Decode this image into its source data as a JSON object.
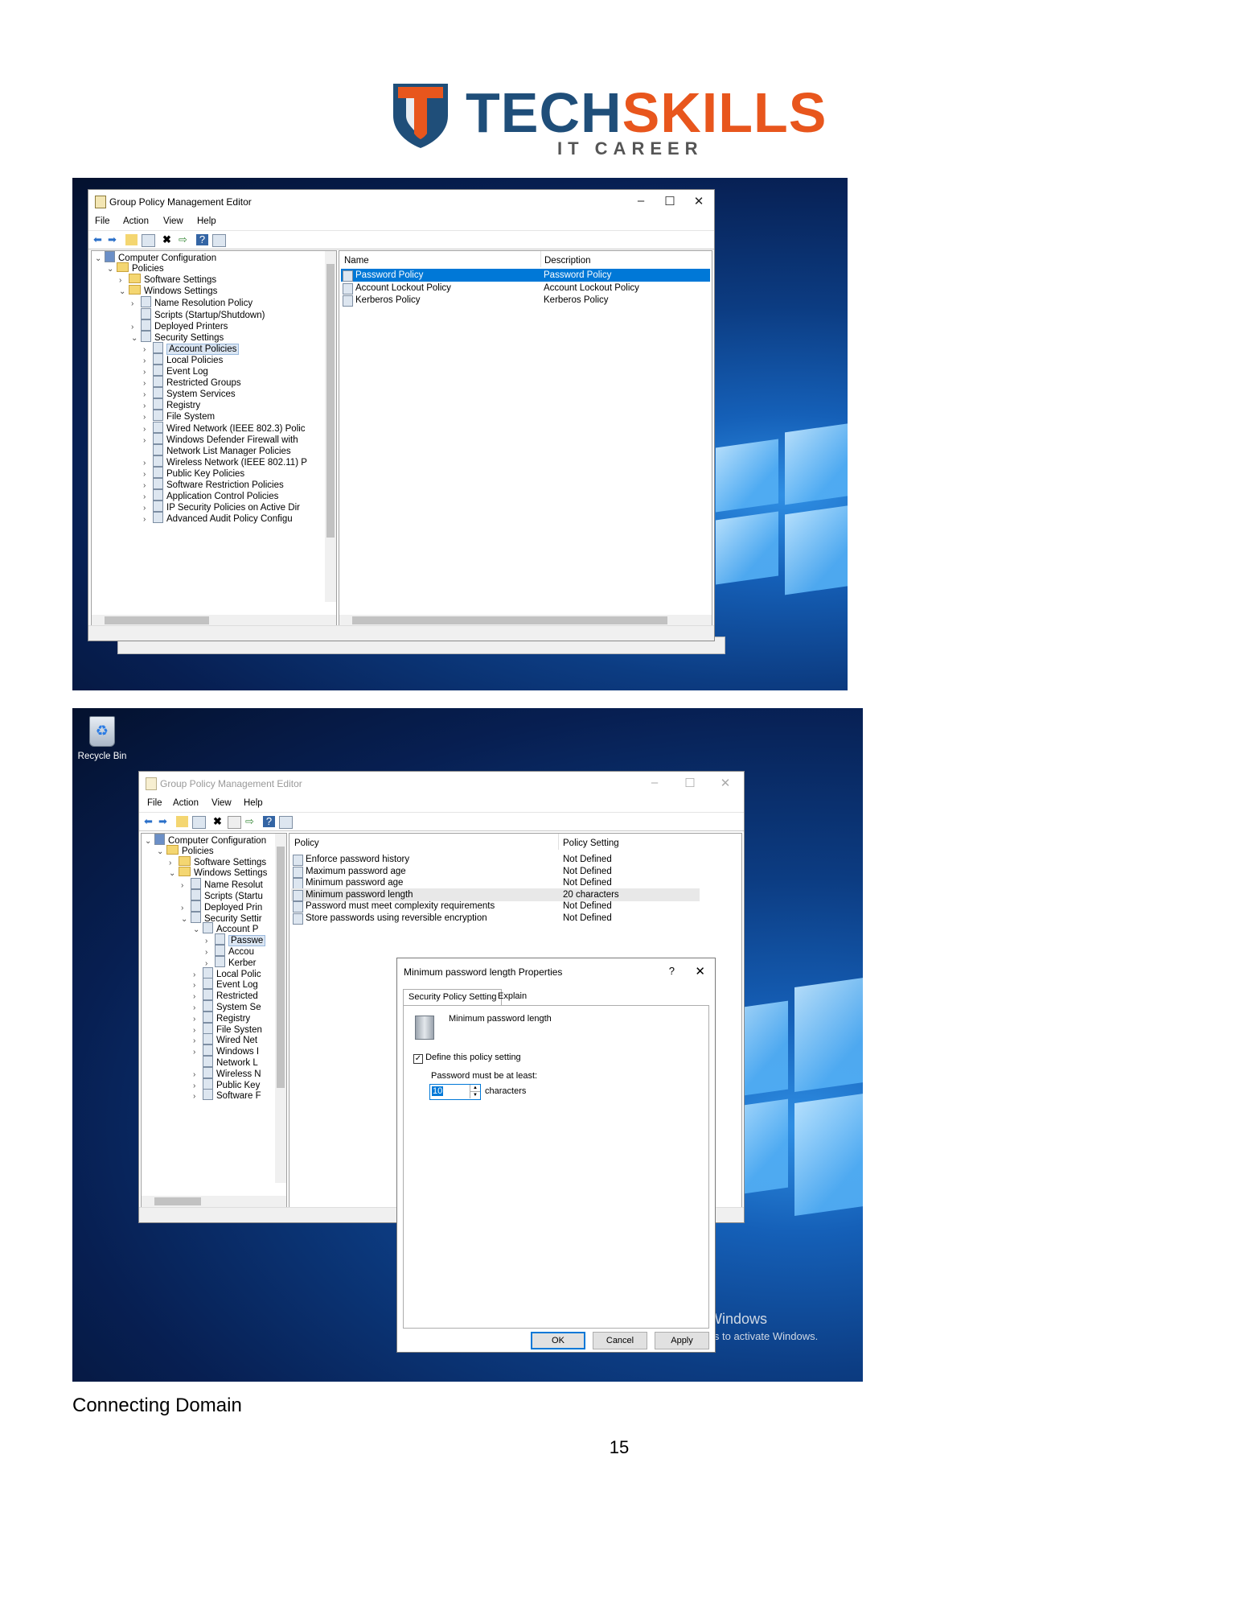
{
  "logo": {
    "brand_part1": "TECH",
    "brand_part2": "SKILLS",
    "tagline": "IT CAREER",
    "colors": {
      "navy": "#1f4e79",
      "orange": "#e8561d"
    }
  },
  "screenshot1": {
    "window_title": "Group Policy Management Editor",
    "window_controls": [
      "–",
      "☐",
      "✕"
    ],
    "menu": [
      "File",
      "Action",
      "View",
      "Help"
    ],
    "tree": [
      {
        "label": "Computer Configuration",
        "indent": 0,
        "arrow": "⌄"
      },
      {
        "label": "Policies",
        "indent": 1,
        "arrow": "⌄"
      },
      {
        "label": "Software Settings",
        "indent": 2,
        "arrow": "›"
      },
      {
        "label": "Windows Settings",
        "indent": 2,
        "arrow": "⌄"
      },
      {
        "label": "Name Resolution Policy",
        "indent": 3,
        "arrow": "›"
      },
      {
        "label": "Scripts (Startup/Shutdown)",
        "indent": 3,
        "arrow": ""
      },
      {
        "label": "Deployed Printers",
        "indent": 3,
        "arrow": "›"
      },
      {
        "label": "Security Settings",
        "indent": 3,
        "arrow": "⌄"
      },
      {
        "label": "Account Policies",
        "indent": 4,
        "arrow": "›",
        "selected": true
      },
      {
        "label": "Local Policies",
        "indent": 4,
        "arrow": "›"
      },
      {
        "label": "Event Log",
        "indent": 4,
        "arrow": "›"
      },
      {
        "label": "Restricted Groups",
        "indent": 4,
        "arrow": "›"
      },
      {
        "label": "System Services",
        "indent": 4,
        "arrow": "›"
      },
      {
        "label": "Registry",
        "indent": 4,
        "arrow": "›"
      },
      {
        "label": "File System",
        "indent": 4,
        "arrow": "›"
      },
      {
        "label": "Wired Network (IEEE 802.3) Polic",
        "indent": 4,
        "arrow": "›"
      },
      {
        "label": "Windows Defender Firewall with",
        "indent": 4,
        "arrow": "›"
      },
      {
        "label": "Network List Manager Policies",
        "indent": 4,
        "arrow": ""
      },
      {
        "label": "Wireless Network (IEEE 802.11) P",
        "indent": 4,
        "arrow": "›"
      },
      {
        "label": "Public Key Policies",
        "indent": 4,
        "arrow": "›"
      },
      {
        "label": "Software Restriction Policies",
        "indent": 4,
        "arrow": "›"
      },
      {
        "label": "Application Control Policies",
        "indent": 4,
        "arrow": "›"
      },
      {
        "label": "IP Security Policies on Active Dir",
        "indent": 4,
        "arrow": "›"
      },
      {
        "label": "Advanced Audit Policy Configu",
        "indent": 4,
        "arrow": "›"
      }
    ],
    "columns": [
      "Name",
      "Description"
    ],
    "rows": [
      {
        "name": "Password Policy",
        "description": "Password Policy",
        "selected": true
      },
      {
        "name": "Account Lockout Policy",
        "description": "Account Lockout Policy"
      },
      {
        "name": "Kerberos Policy",
        "description": "Kerberos Policy"
      }
    ]
  },
  "screenshot2": {
    "recycle_bin": "Recycle Bin",
    "window_title": "Group Policy Management Editor",
    "window_controls": [
      "–",
      "☐",
      "✕"
    ],
    "menu": [
      "File",
      "Action",
      "View",
      "Help"
    ],
    "tree": [
      {
        "label": "Computer Configuration",
        "indent": 0,
        "arrow": "⌄"
      },
      {
        "label": "Policies",
        "indent": 1,
        "arrow": "⌄"
      },
      {
        "label": "Software Settings",
        "indent": 2,
        "arrow": "›"
      },
      {
        "label": "Windows Settings",
        "indent": 2,
        "arrow": "⌄"
      },
      {
        "label": "Name Resolut",
        "indent": 3,
        "arrow": "›"
      },
      {
        "label": "Scripts (Startu",
        "indent": 3,
        "arrow": ""
      },
      {
        "label": "Deployed Prin",
        "indent": 3,
        "arrow": "›"
      },
      {
        "label": "Security Settir",
        "indent": 3,
        "arrow": "⌄"
      },
      {
        "label": "Account P",
        "indent": 4,
        "arrow": "⌄"
      },
      {
        "label": "Passwe",
        "indent": 5,
        "arrow": "›",
        "selected": true
      },
      {
        "label": "Accou",
        "indent": 5,
        "arrow": "›"
      },
      {
        "label": "Kerber",
        "indent": 5,
        "arrow": "›"
      },
      {
        "label": "Local Polic",
        "indent": 4,
        "arrow": "›"
      },
      {
        "label": "Event Log",
        "indent": 4,
        "arrow": "›"
      },
      {
        "label": "Restricted",
        "indent": 4,
        "arrow": "›"
      },
      {
        "label": "System Se",
        "indent": 4,
        "arrow": "›"
      },
      {
        "label": "Registry",
        "indent": 4,
        "arrow": "›"
      },
      {
        "label": "File Systen",
        "indent": 4,
        "arrow": "›"
      },
      {
        "label": "Wired Net",
        "indent": 4,
        "arrow": "›"
      },
      {
        "label": "Windows I",
        "indent": 4,
        "arrow": "›"
      },
      {
        "label": "Network L",
        "indent": 4,
        "arrow": ""
      },
      {
        "label": "Wireless N",
        "indent": 4,
        "arrow": "›"
      },
      {
        "label": "Public Key",
        "indent": 4,
        "arrow": "›"
      },
      {
        "label": "Software F",
        "indent": 4,
        "arrow": "›"
      }
    ],
    "columns": [
      "Policy",
      "Policy Setting"
    ],
    "rows": [
      {
        "policy": "Enforce password history",
        "setting": "Not Defined"
      },
      {
        "policy": "Maximum password age",
        "setting": "Not Defined"
      },
      {
        "policy": "Minimum password age",
        "setting": "Not Defined"
      },
      {
        "policy": "Minimum password length",
        "setting": "20 characters",
        "highlighted": true
      },
      {
        "policy": "Password must meet complexity requirements",
        "setting": "Not Defined"
      },
      {
        "policy": "Store passwords using reversible encryption",
        "setting": "Not Defined"
      }
    ],
    "dialog": {
      "title": "Minimum password length Properties",
      "help": "?",
      "close": "✕",
      "tabs": [
        "Security Policy Setting",
        "Explain"
      ],
      "setting_name": "Minimum password length",
      "checkbox_label": "Define this policy setting",
      "checked": true,
      "field_label": "Password must be at least:",
      "value": "10",
      "unit": "characters",
      "buttons": {
        "ok": "OK",
        "cancel": "Cancel",
        "apply": "Apply"
      }
    },
    "watermark": {
      "line1": "Activate Windows",
      "line2": "Go to Settings to activate Windows."
    }
  },
  "caption": "Connecting Domain",
  "page_number": "15"
}
